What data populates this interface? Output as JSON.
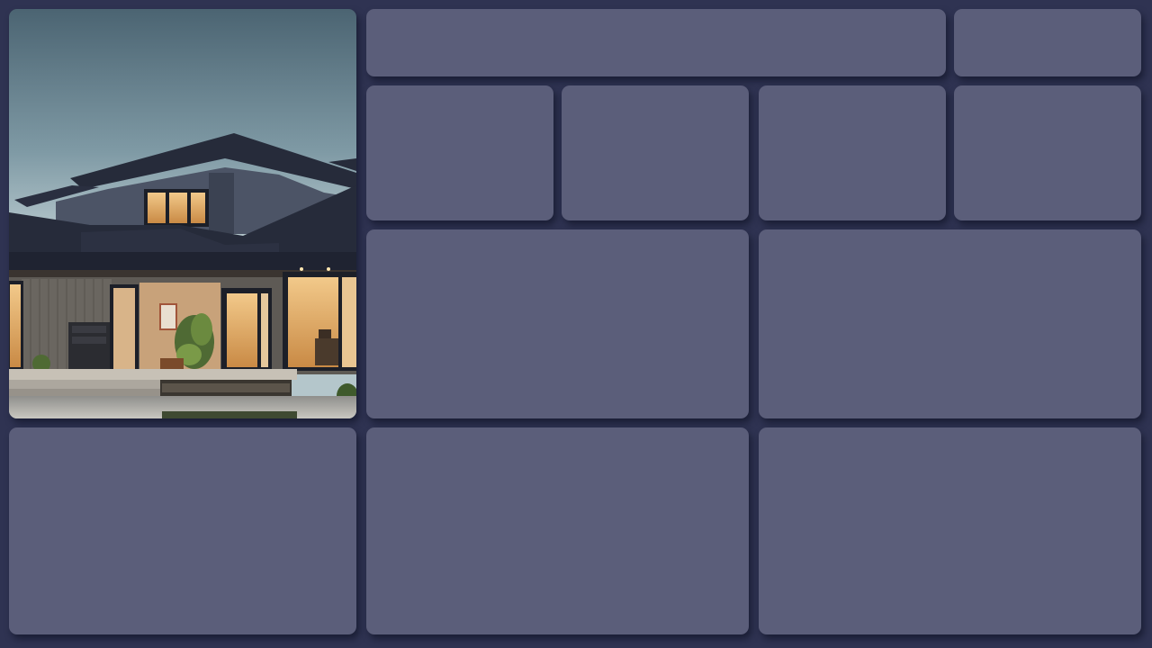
{
  "page": {
    "background_color": "#2f3352",
    "tile_color": "#5b5e7a"
  },
  "hero_tile": {
    "image_subject": "modern-house-at-dusk"
  },
  "tiles": [
    {
      "name": "tile-top-wide",
      "text": ""
    },
    {
      "name": "tile-top-right",
      "text": ""
    },
    {
      "name": "tile-row2-1",
      "text": ""
    },
    {
      "name": "tile-row2-2",
      "text": ""
    },
    {
      "name": "tile-row2-3",
      "text": ""
    },
    {
      "name": "tile-row2-4",
      "text": ""
    },
    {
      "name": "tile-mid-left",
      "text": ""
    },
    {
      "name": "tile-mid-right",
      "text": ""
    },
    {
      "name": "tile-bottom-left",
      "text": ""
    },
    {
      "name": "tile-bottom-middle",
      "text": ""
    },
    {
      "name": "tile-bottom-right",
      "text": ""
    }
  ]
}
